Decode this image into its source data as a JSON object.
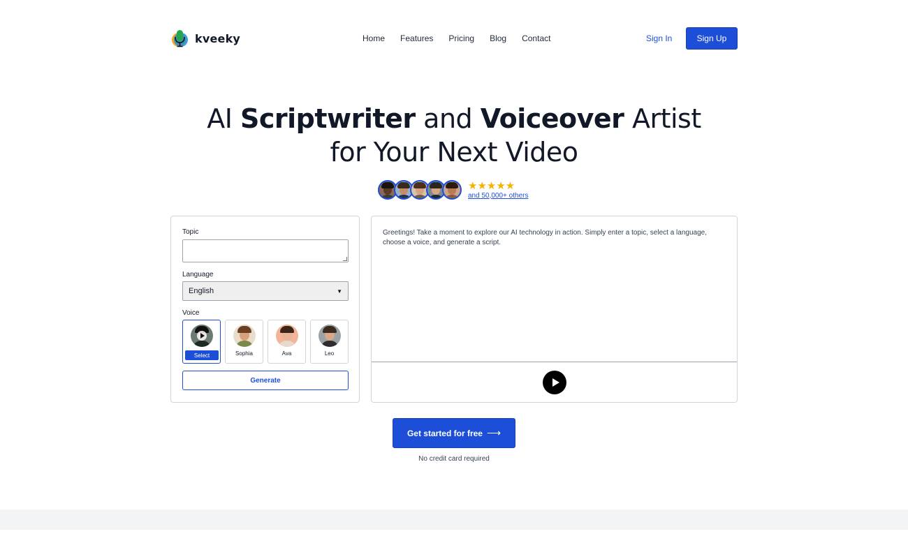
{
  "brand": {
    "name": "kveeky",
    "icon": "microphone-logo-icon"
  },
  "nav": {
    "items": [
      {
        "label": "Home"
      },
      {
        "label": "Features"
      },
      {
        "label": "Pricing"
      },
      {
        "label": "Blog"
      },
      {
        "label": "Contact"
      }
    ],
    "sign_in": "Sign In",
    "sign_up": "Sign Up"
  },
  "hero": {
    "line1_a": "AI ",
    "line1_b": "Scriptwriter",
    "line1_c": " and ",
    "line1_d": "Voiceover",
    "line1_e": " Artist",
    "line2": "for Your Next Video"
  },
  "social_proof": {
    "stars": "★★★★★",
    "others": "and 50,000+ others",
    "avatar_count": 5
  },
  "form": {
    "topic_label": "Topic",
    "topic_value": "",
    "language_label": "Language",
    "language_value": "English",
    "voice_label": "Voice",
    "voices": [
      {
        "name": "",
        "select_label": "Select",
        "selected": true
      },
      {
        "name": "Sophia"
      },
      {
        "name": "Ava"
      },
      {
        "name": "Leo"
      }
    ],
    "generate": "Generate"
  },
  "output": {
    "text": "Greetings! Take a moment to explore our AI technology in action. Simply enter a topic, select a language, choose a voice, and generate a script."
  },
  "cta": {
    "label": "Get started for free",
    "arrow": "⟶",
    "note": "No credit card required"
  },
  "colors": {
    "accent": "#1d4ed8",
    "star": "#f5b301",
    "footer_band": "#f3f4f6"
  }
}
